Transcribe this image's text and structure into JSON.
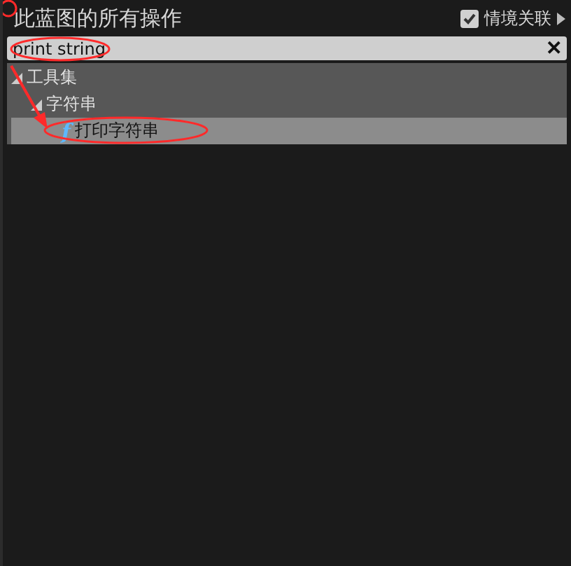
{
  "header": {
    "title": "此蓝图的所有操作",
    "context": {
      "label": "情境关联",
      "checked": true
    }
  },
  "search": {
    "value": "print string",
    "clear": "✕"
  },
  "tree": [
    {
      "label": "工具集",
      "expanded": true,
      "selected": false,
      "children": [
        {
          "label": "字符串",
          "expanded": true,
          "selected": false,
          "children": [
            {
              "label": "打印字符串",
              "icon": "f",
              "selected": true
            }
          ]
        }
      ]
    }
  ],
  "annotations": [
    {
      "kind": "corner-circle"
    },
    {
      "kind": "search-ring"
    },
    {
      "kind": "arrow"
    },
    {
      "kind": "item-ring"
    }
  ]
}
